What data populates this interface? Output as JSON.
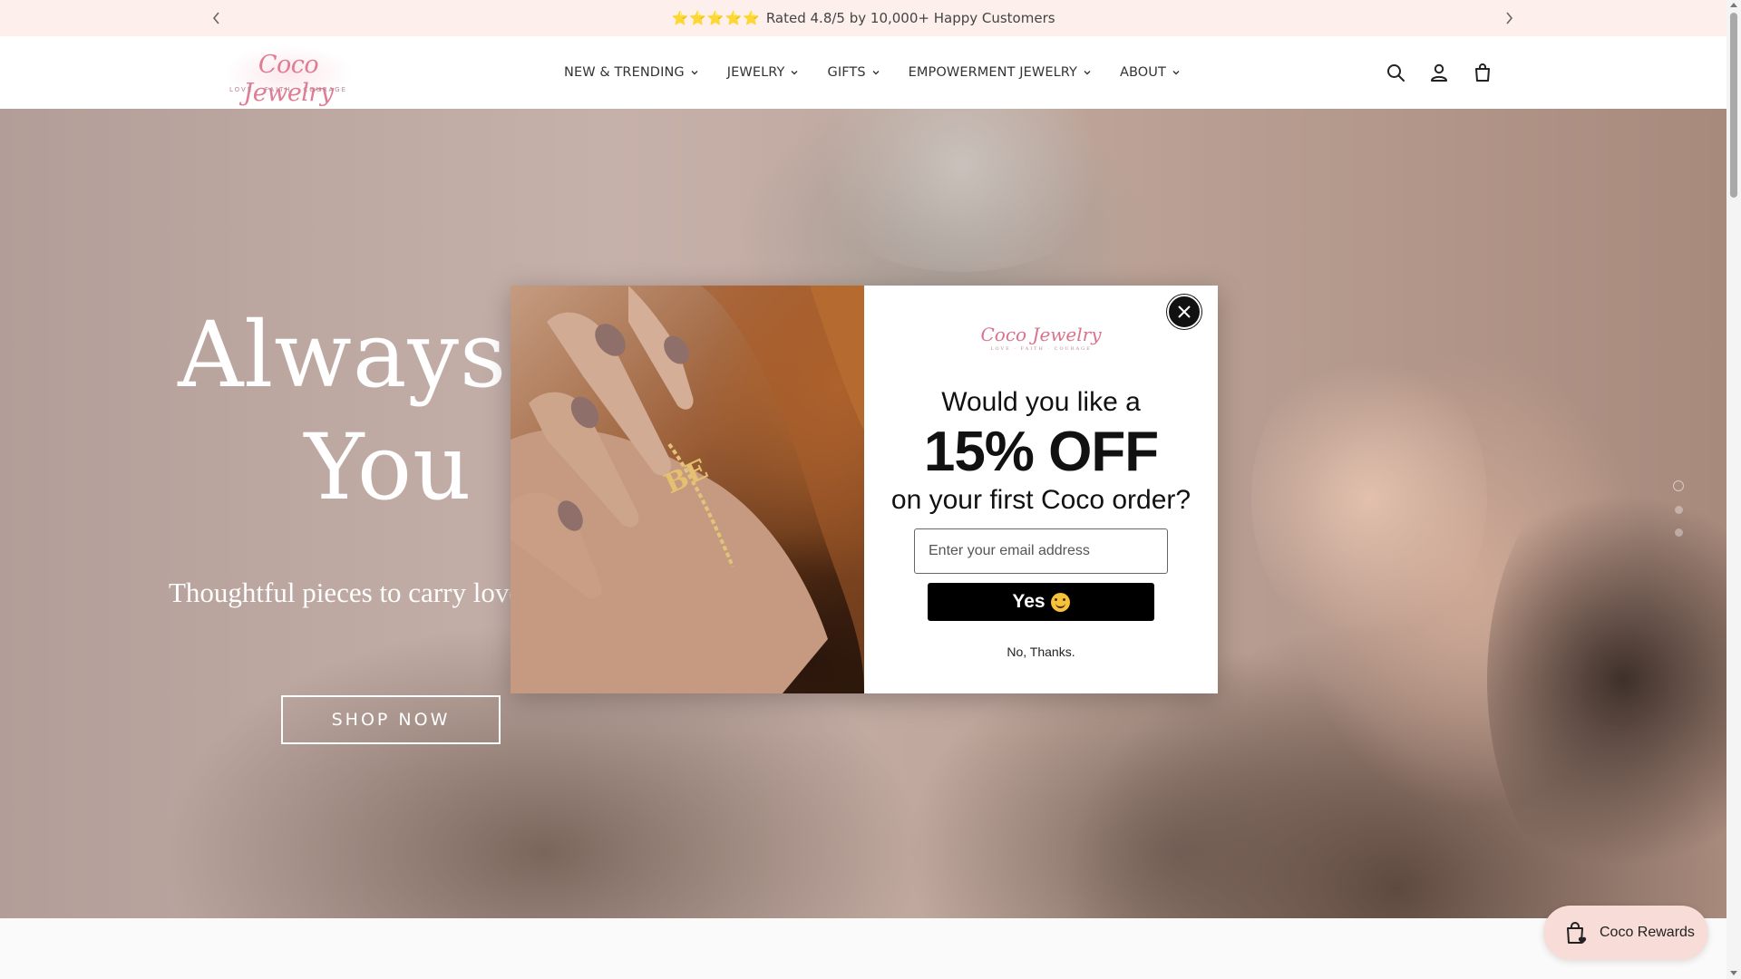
{
  "announcement": {
    "stars": "⭐⭐⭐⭐⭐",
    "text": "Rated 4.8/5 by 10,000+ Happy Customers"
  },
  "logo": {
    "name": "Coco Jewelry",
    "tagline": "LOVE · FAITH · COURAGE"
  },
  "nav": {
    "items": [
      {
        "label": "NEW & TRENDING"
      },
      {
        "label": "JEWELRY"
      },
      {
        "label": "GIFTS"
      },
      {
        "label": "EMPOWERMENT JEWELRY"
      },
      {
        "label": "ABOUT"
      }
    ]
  },
  "header_icons": [
    "search-icon",
    "account-icon",
    "cart-icon"
  ],
  "hero": {
    "title_line1": "Always W",
    "title_line2": "You",
    "subtitle": "Thoughtful pieces to carry love",
    "button_label": "SHOP NOW",
    "slide_count": 3,
    "active_slide": 1
  },
  "popup": {
    "logo_name": "Coco Jewelry",
    "logo_tagline": "LOVE · FAITH · COURAGE",
    "line1": "Would you like a",
    "line2": "15% OFF",
    "line3": "on your first Coco order?",
    "email_placeholder": "Enter your email address",
    "yes_label": "Yes",
    "no_label": "No, Thanks."
  },
  "rewards": {
    "label": "Coco Rewards"
  },
  "colors": {
    "announcement_bg": "#fcefec",
    "brand_pink": "#e07c93",
    "rewards_bg": "#f7dcd7",
    "star": "#f3c21a"
  }
}
